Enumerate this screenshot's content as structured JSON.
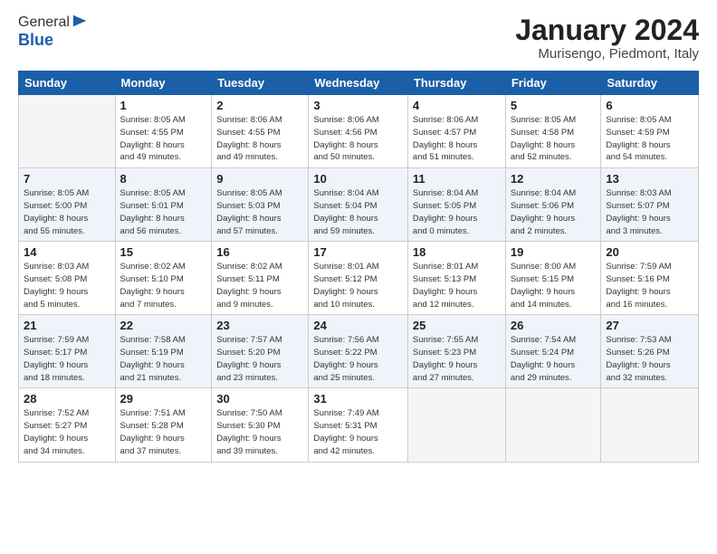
{
  "logo": {
    "general": "General",
    "blue": "Blue"
  },
  "title": "January 2024",
  "subtitle": "Murisengo, Piedmont, Italy",
  "days_header": [
    "Sunday",
    "Monday",
    "Tuesday",
    "Wednesday",
    "Thursday",
    "Friday",
    "Saturday"
  ],
  "weeks": [
    [
      {
        "num": "",
        "info": ""
      },
      {
        "num": "1",
        "info": "Sunrise: 8:05 AM\nSunset: 4:55 PM\nDaylight: 8 hours\nand 49 minutes."
      },
      {
        "num": "2",
        "info": "Sunrise: 8:06 AM\nSunset: 4:55 PM\nDaylight: 8 hours\nand 49 minutes."
      },
      {
        "num": "3",
        "info": "Sunrise: 8:06 AM\nSunset: 4:56 PM\nDaylight: 8 hours\nand 50 minutes."
      },
      {
        "num": "4",
        "info": "Sunrise: 8:06 AM\nSunset: 4:57 PM\nDaylight: 8 hours\nand 51 minutes."
      },
      {
        "num": "5",
        "info": "Sunrise: 8:05 AM\nSunset: 4:58 PM\nDaylight: 8 hours\nand 52 minutes."
      },
      {
        "num": "6",
        "info": "Sunrise: 8:05 AM\nSunset: 4:59 PM\nDaylight: 8 hours\nand 54 minutes."
      }
    ],
    [
      {
        "num": "7",
        "info": "Sunrise: 8:05 AM\nSunset: 5:00 PM\nDaylight: 8 hours\nand 55 minutes."
      },
      {
        "num": "8",
        "info": "Sunrise: 8:05 AM\nSunset: 5:01 PM\nDaylight: 8 hours\nand 56 minutes."
      },
      {
        "num": "9",
        "info": "Sunrise: 8:05 AM\nSunset: 5:03 PM\nDaylight: 8 hours\nand 57 minutes."
      },
      {
        "num": "10",
        "info": "Sunrise: 8:04 AM\nSunset: 5:04 PM\nDaylight: 8 hours\nand 59 minutes."
      },
      {
        "num": "11",
        "info": "Sunrise: 8:04 AM\nSunset: 5:05 PM\nDaylight: 9 hours\nand 0 minutes."
      },
      {
        "num": "12",
        "info": "Sunrise: 8:04 AM\nSunset: 5:06 PM\nDaylight: 9 hours\nand 2 minutes."
      },
      {
        "num": "13",
        "info": "Sunrise: 8:03 AM\nSunset: 5:07 PM\nDaylight: 9 hours\nand 3 minutes."
      }
    ],
    [
      {
        "num": "14",
        "info": "Sunrise: 8:03 AM\nSunset: 5:08 PM\nDaylight: 9 hours\nand 5 minutes."
      },
      {
        "num": "15",
        "info": "Sunrise: 8:02 AM\nSunset: 5:10 PM\nDaylight: 9 hours\nand 7 minutes."
      },
      {
        "num": "16",
        "info": "Sunrise: 8:02 AM\nSunset: 5:11 PM\nDaylight: 9 hours\nand 9 minutes."
      },
      {
        "num": "17",
        "info": "Sunrise: 8:01 AM\nSunset: 5:12 PM\nDaylight: 9 hours\nand 10 minutes."
      },
      {
        "num": "18",
        "info": "Sunrise: 8:01 AM\nSunset: 5:13 PM\nDaylight: 9 hours\nand 12 minutes."
      },
      {
        "num": "19",
        "info": "Sunrise: 8:00 AM\nSunset: 5:15 PM\nDaylight: 9 hours\nand 14 minutes."
      },
      {
        "num": "20",
        "info": "Sunrise: 7:59 AM\nSunset: 5:16 PM\nDaylight: 9 hours\nand 16 minutes."
      }
    ],
    [
      {
        "num": "21",
        "info": "Sunrise: 7:59 AM\nSunset: 5:17 PM\nDaylight: 9 hours\nand 18 minutes."
      },
      {
        "num": "22",
        "info": "Sunrise: 7:58 AM\nSunset: 5:19 PM\nDaylight: 9 hours\nand 21 minutes."
      },
      {
        "num": "23",
        "info": "Sunrise: 7:57 AM\nSunset: 5:20 PM\nDaylight: 9 hours\nand 23 minutes."
      },
      {
        "num": "24",
        "info": "Sunrise: 7:56 AM\nSunset: 5:22 PM\nDaylight: 9 hours\nand 25 minutes."
      },
      {
        "num": "25",
        "info": "Sunrise: 7:55 AM\nSunset: 5:23 PM\nDaylight: 9 hours\nand 27 minutes."
      },
      {
        "num": "26",
        "info": "Sunrise: 7:54 AM\nSunset: 5:24 PM\nDaylight: 9 hours\nand 29 minutes."
      },
      {
        "num": "27",
        "info": "Sunrise: 7:53 AM\nSunset: 5:26 PM\nDaylight: 9 hours\nand 32 minutes."
      }
    ],
    [
      {
        "num": "28",
        "info": "Sunrise: 7:52 AM\nSunset: 5:27 PM\nDaylight: 9 hours\nand 34 minutes."
      },
      {
        "num": "29",
        "info": "Sunrise: 7:51 AM\nSunset: 5:28 PM\nDaylight: 9 hours\nand 37 minutes."
      },
      {
        "num": "30",
        "info": "Sunrise: 7:50 AM\nSunset: 5:30 PM\nDaylight: 9 hours\nand 39 minutes."
      },
      {
        "num": "31",
        "info": "Sunrise: 7:49 AM\nSunset: 5:31 PM\nDaylight: 9 hours\nand 42 minutes."
      },
      {
        "num": "",
        "info": ""
      },
      {
        "num": "",
        "info": ""
      },
      {
        "num": "",
        "info": ""
      }
    ]
  ]
}
